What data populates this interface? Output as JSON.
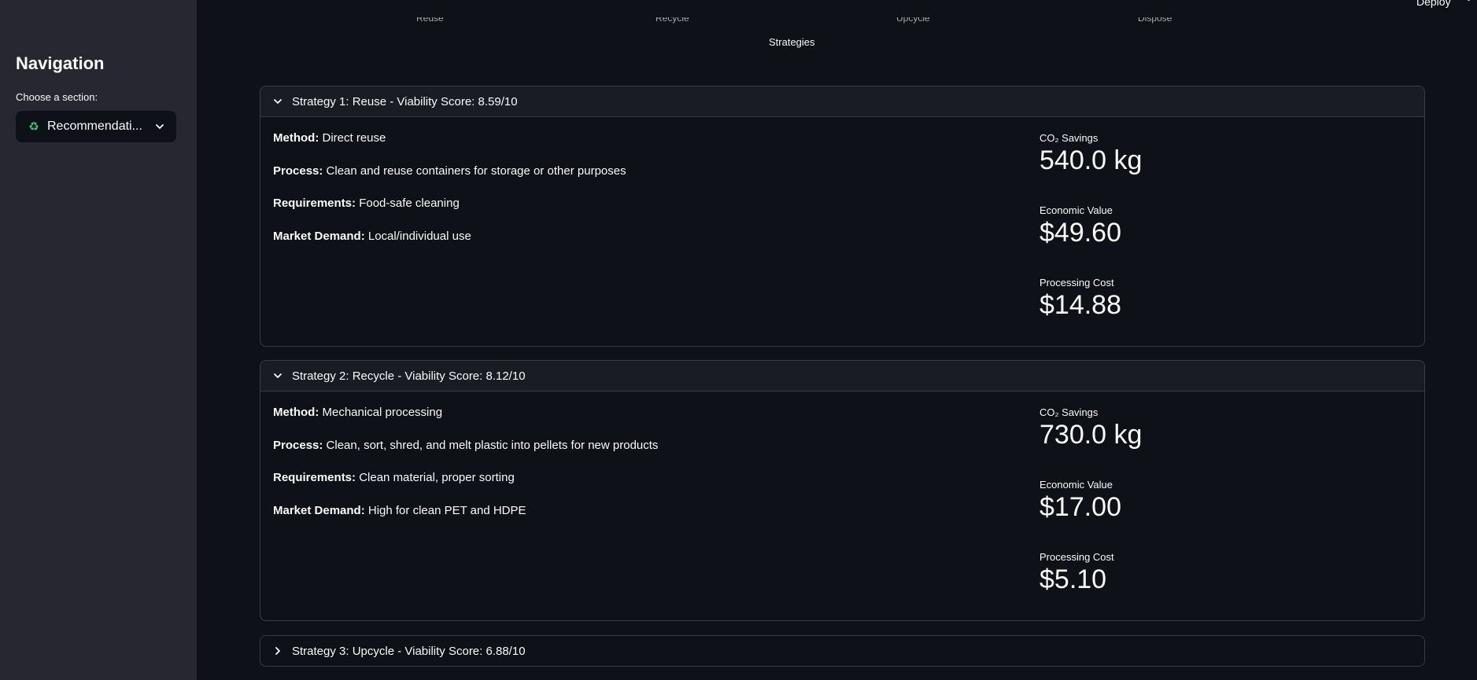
{
  "sidebar": {
    "title": "Navigation",
    "select_label": "Choose a section:",
    "selected_value": "Recommendati...",
    "selected_icon": "recycle-icon"
  },
  "topbar": {
    "deploy_label": "Deploy"
  },
  "chart": {
    "tick_labels": [
      "Reuse",
      "Recycle",
      "Upcycle",
      "Dispose"
    ],
    "axis_title": "Strategies"
  },
  "strategies": [
    {
      "title": "Strategy 1: Reuse - Viability Score: 8.59/10",
      "expanded": true,
      "method_label": "Method:",
      "method": "Direct reuse",
      "process_label": "Process:",
      "process": "Clean and reuse containers for storage or other purposes",
      "requirements_label": "Requirements:",
      "requirements": "Food-safe cleaning",
      "market_label": "Market Demand:",
      "market": "Local/individual use",
      "co2_label": "CO₂ Savings",
      "co2_value": "540.0 kg",
      "econ_label": "Economic Value",
      "econ_value": "$49.60",
      "cost_label": "Processing Cost",
      "cost_value": "$14.88"
    },
    {
      "title": "Strategy 2: Recycle - Viability Score: 8.12/10",
      "expanded": true,
      "method_label": "Method:",
      "method": "Mechanical processing",
      "process_label": "Process:",
      "process": "Clean, sort, shred, and melt plastic into pellets for new products",
      "requirements_label": "Requirements:",
      "requirements": "Clean material, proper sorting",
      "market_label": "Market Demand:",
      "market": "High for clean PET and HDPE",
      "co2_label": "CO₂ Savings",
      "co2_value": "730.0 kg",
      "econ_label": "Economic Value",
      "econ_value": "$17.00",
      "cost_label": "Processing Cost",
      "cost_value": "$5.10"
    },
    {
      "title": "Strategy 3: Upcycle - Viability Score: 6.88/10",
      "expanded": false
    }
  ],
  "colors": {
    "background": "#0e1117",
    "sidebar": "#262730",
    "accent_icon": "#3ec97a"
  }
}
